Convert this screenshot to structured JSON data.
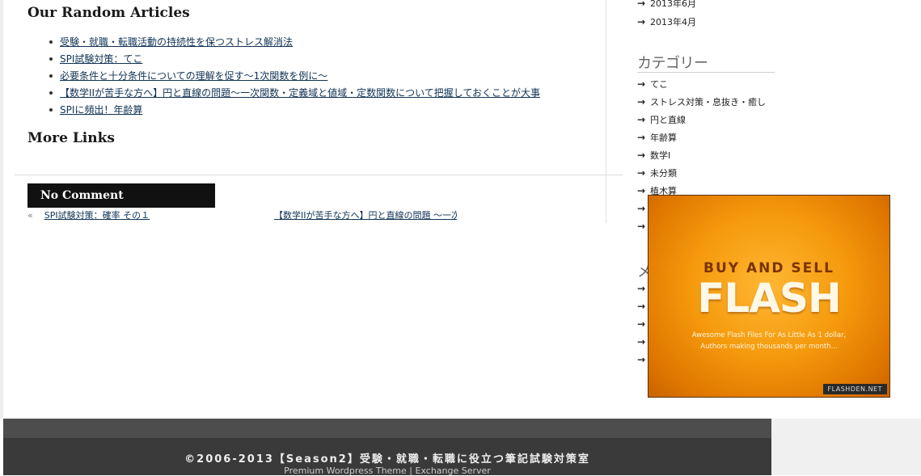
{
  "main": {
    "random_title": "Our Random Articles",
    "articles": [
      "受験・就職・転職活動の持続性を保つストレス解消法",
      "SPI試験対策：てこ",
      "必要条件と十分条件についての理解を促す～1次関数を例に～",
      "【数学IIが苦手な方へ】円と直線の問題～一次関数・定義域と値域・定数関数について把握しておくことが大事",
      "SPIに頻出！年齢算"
    ],
    "links_title": "More Links",
    "comment_label": "No Comment",
    "nav": {
      "prev_arrow": "«",
      "prev_label": "SPI試験対策：確率 その１",
      "next_label": "【数学IIが苦手な方へ】円と直線の問題 ～一次関"
    }
  },
  "sidebar": {
    "archives": [
      "2013年6月",
      "2013年4月"
    ],
    "categories_title": "カテゴリー",
    "categories": [
      "てこ",
      "ストレス対策・息抜き・癒し",
      "円と直線",
      "年齢算",
      "数学I",
      "未分類",
      "植木算"
    ],
    "meta_title_visible": "メ"
  },
  "ad": {
    "headline_top": "BUY AND SELL",
    "headline_main": "FLASH",
    "tagline_1": "Awesome Flash Files For As Little As 1 dollar,",
    "tagline_2": "Authors making thousands per month...",
    "badge": "FLASHDEN.NET"
  },
  "footer": {
    "copyright": "©2006-2013【Season2】受験・就職・転職に役立つ筆記試験対策室",
    "theme_link": "Premium Wordpress Theme",
    "separator": "|",
    "server_link": "Exchange Server"
  }
}
